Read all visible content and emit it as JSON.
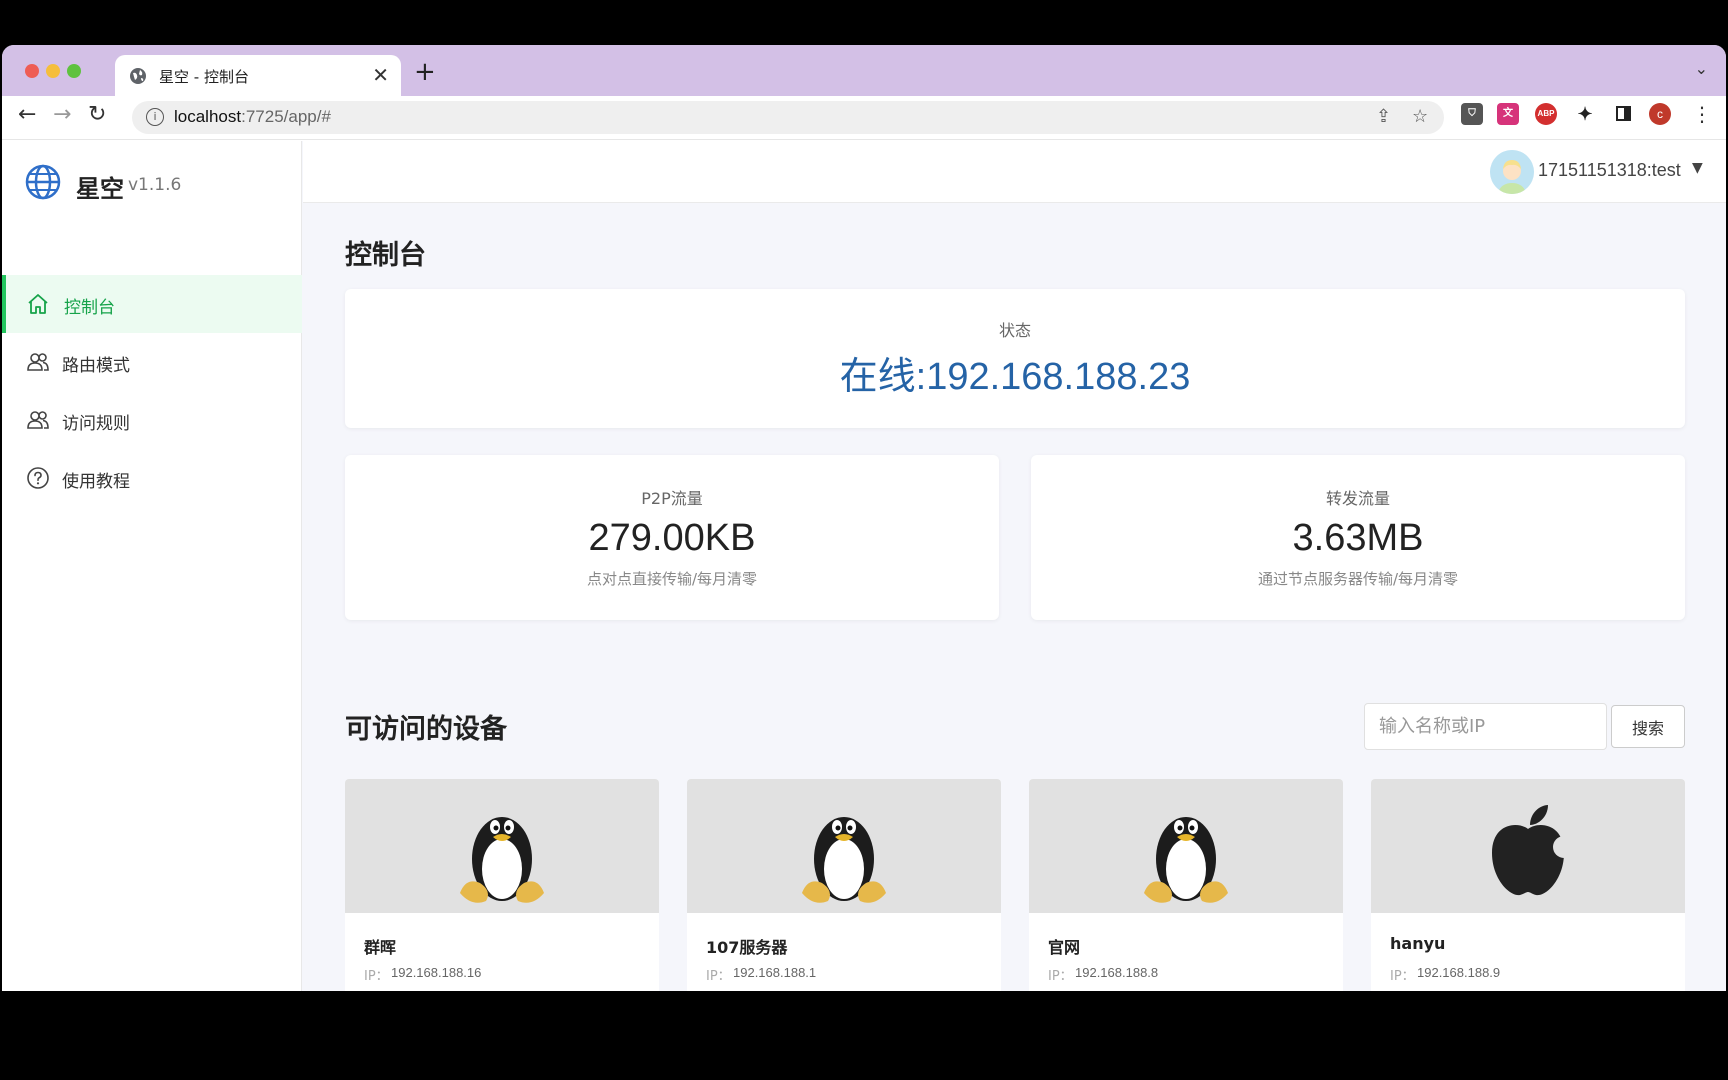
{
  "browser": {
    "tab_title": "星空 - 控制台",
    "url_host": "localhost",
    "url_rest": ":7725/app/#",
    "profile_initial": "c",
    "ext_abp": "ABP"
  },
  "sidebar": {
    "brand_name": "星空",
    "version": "v1.1.6",
    "items": [
      {
        "label": "控制台",
        "icon": "home-icon",
        "active": true
      },
      {
        "label": "路由模式",
        "icon": "users-icon",
        "active": false
      },
      {
        "label": "访问规则",
        "icon": "users-icon",
        "active": false
      },
      {
        "label": "使用教程",
        "icon": "help-icon",
        "active": false
      }
    ]
  },
  "header": {
    "username": "17151151318:test"
  },
  "main": {
    "title": "控制台",
    "status": {
      "label": "状态",
      "value": "在线:192.168.188.23"
    },
    "p2p": {
      "label": "P2P流量",
      "value": "279.00KB",
      "desc": "点对点直接传输/每月清零"
    },
    "relay": {
      "label": "转发流量",
      "value": "3.63MB",
      "desc": "通过节点服务器传输/每月清零"
    },
    "devices_title": "可访问的设备",
    "search_placeholder": "输入名称或IP",
    "search_button": "搜索",
    "ip_label": "IP：",
    "devices": [
      {
        "name": "群晖",
        "ip": "192.168.188.16",
        "os": "linux"
      },
      {
        "name": "107服务器",
        "ip": "192.168.188.1",
        "os": "linux"
      },
      {
        "name": "官网",
        "ip": "192.168.188.8",
        "os": "linux"
      },
      {
        "name": "hanyu",
        "ip": "192.168.188.9",
        "os": "apple"
      }
    ]
  },
  "colors": {
    "accent_green": "#22c55e",
    "status_blue": "#2563a6",
    "tabstrip": "#d3c0e6"
  }
}
